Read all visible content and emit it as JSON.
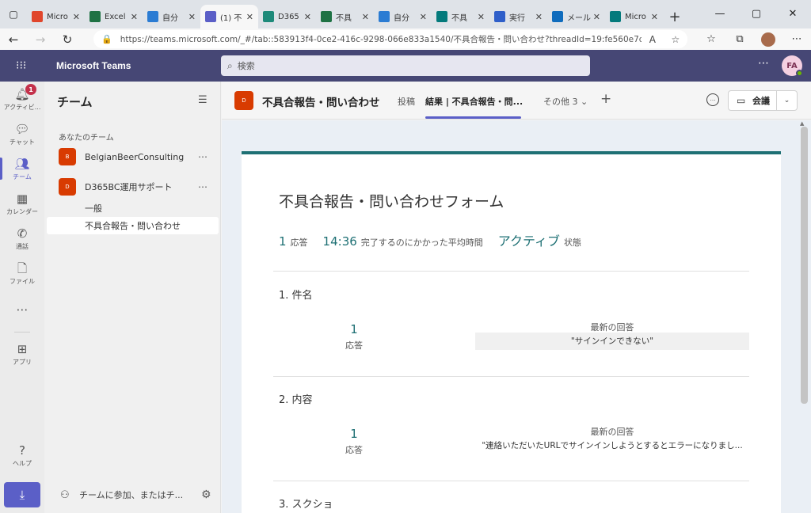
{
  "browser": {
    "tabs": [
      {
        "label": "Micro",
        "icon": "office-icon",
        "color": "#e0462c"
      },
      {
        "label": "Excel",
        "icon": "excel-icon",
        "color": "#1f7244"
      },
      {
        "label": "自分",
        "icon": "onedrive-icon",
        "color": "#2b7cd3"
      },
      {
        "label": "(1) 不",
        "icon": "teams-icon",
        "color": "#5b5fc7"
      },
      {
        "label": "D365",
        "icon": "d365-icon",
        "color": "#1e8a7a"
      },
      {
        "label": "不具",
        "icon": "excel-icon",
        "color": "#1f7244"
      },
      {
        "label": "自分",
        "icon": "onedrive-icon",
        "color": "#2b7cd3"
      },
      {
        "label": "不具",
        "icon": "forms-icon",
        "color": "#047a7c"
      },
      {
        "label": "実行",
        "icon": "power-automate-icon",
        "color": "#2f5fc9"
      },
      {
        "label": "メール",
        "icon": "outlook-icon",
        "color": "#0f6cbd"
      },
      {
        "label": "Micro",
        "icon": "forms-icon",
        "color": "#047a7c"
      }
    ],
    "active_tab_index": 3,
    "url": "https://teams.microsoft.com/_#/tab::583913f4-0ce2-416c-9298-066e833a1540/不具合報告・問い合わせ?threadId=19:fe560e7dc5ef..."
  },
  "teams": {
    "app_title": "Microsoft Teams",
    "search_placeholder": "検索",
    "avatar_initials": "FA",
    "rail": [
      {
        "label": "アクティビ...",
        "icon": "bell-icon",
        "badge": "1"
      },
      {
        "label": "チャット",
        "icon": "chat-icon"
      },
      {
        "label": "チーム",
        "icon": "teams-icon",
        "active": true
      },
      {
        "label": "カレンダー",
        "icon": "calendar-icon"
      },
      {
        "label": "通話",
        "icon": "phone-icon"
      },
      {
        "label": "ファイル",
        "icon": "file-icon"
      },
      {
        "label": "",
        "icon": "more-icon"
      },
      {
        "label": "アプリ",
        "icon": "apps-icon"
      },
      {
        "label": "ヘルプ",
        "icon": "help-icon"
      }
    ],
    "panel": {
      "title": "チーム",
      "section_label": "あなたのチーム",
      "teams": [
        {
          "name": "BelgianBeerConsulting",
          "initial": "B"
        },
        {
          "name": "D365BC運用サポート",
          "initial": "D"
        }
      ],
      "channels": [
        "一般",
        "不具合報告・問い合わせ"
      ],
      "join_label": "チームに参加、またはチ..."
    },
    "channel_header": {
      "icon_initial": "D",
      "name": "不具合報告・問い合わせ",
      "tabs": [
        "投稿",
        "結果 | 不具合報告・問...",
        "その他 3"
      ],
      "meet_label": "会議"
    },
    "form": {
      "title": "不具合報告・問い合わせフォーム",
      "responses_count": "1",
      "responses_label": "応答",
      "avg_time": "14:36",
      "avg_time_label": "完了するのにかかった平均時間",
      "status": "アクティブ",
      "status_label": "状態",
      "questions": [
        {
          "title": "1.  件名",
          "count": "1",
          "count_label": "応答",
          "latest_label": "最新の回答",
          "latest_answer": "\"サインインできない\""
        },
        {
          "title": "2.  内容",
          "count": "1",
          "count_label": "応答",
          "latest_label": "最新の回答",
          "latest_answer": "\"連絡いただいたURLでサインインしようとするとエラーになりまし..."
        },
        {
          "title": "3.  スクショ"
        }
      ]
    }
  }
}
